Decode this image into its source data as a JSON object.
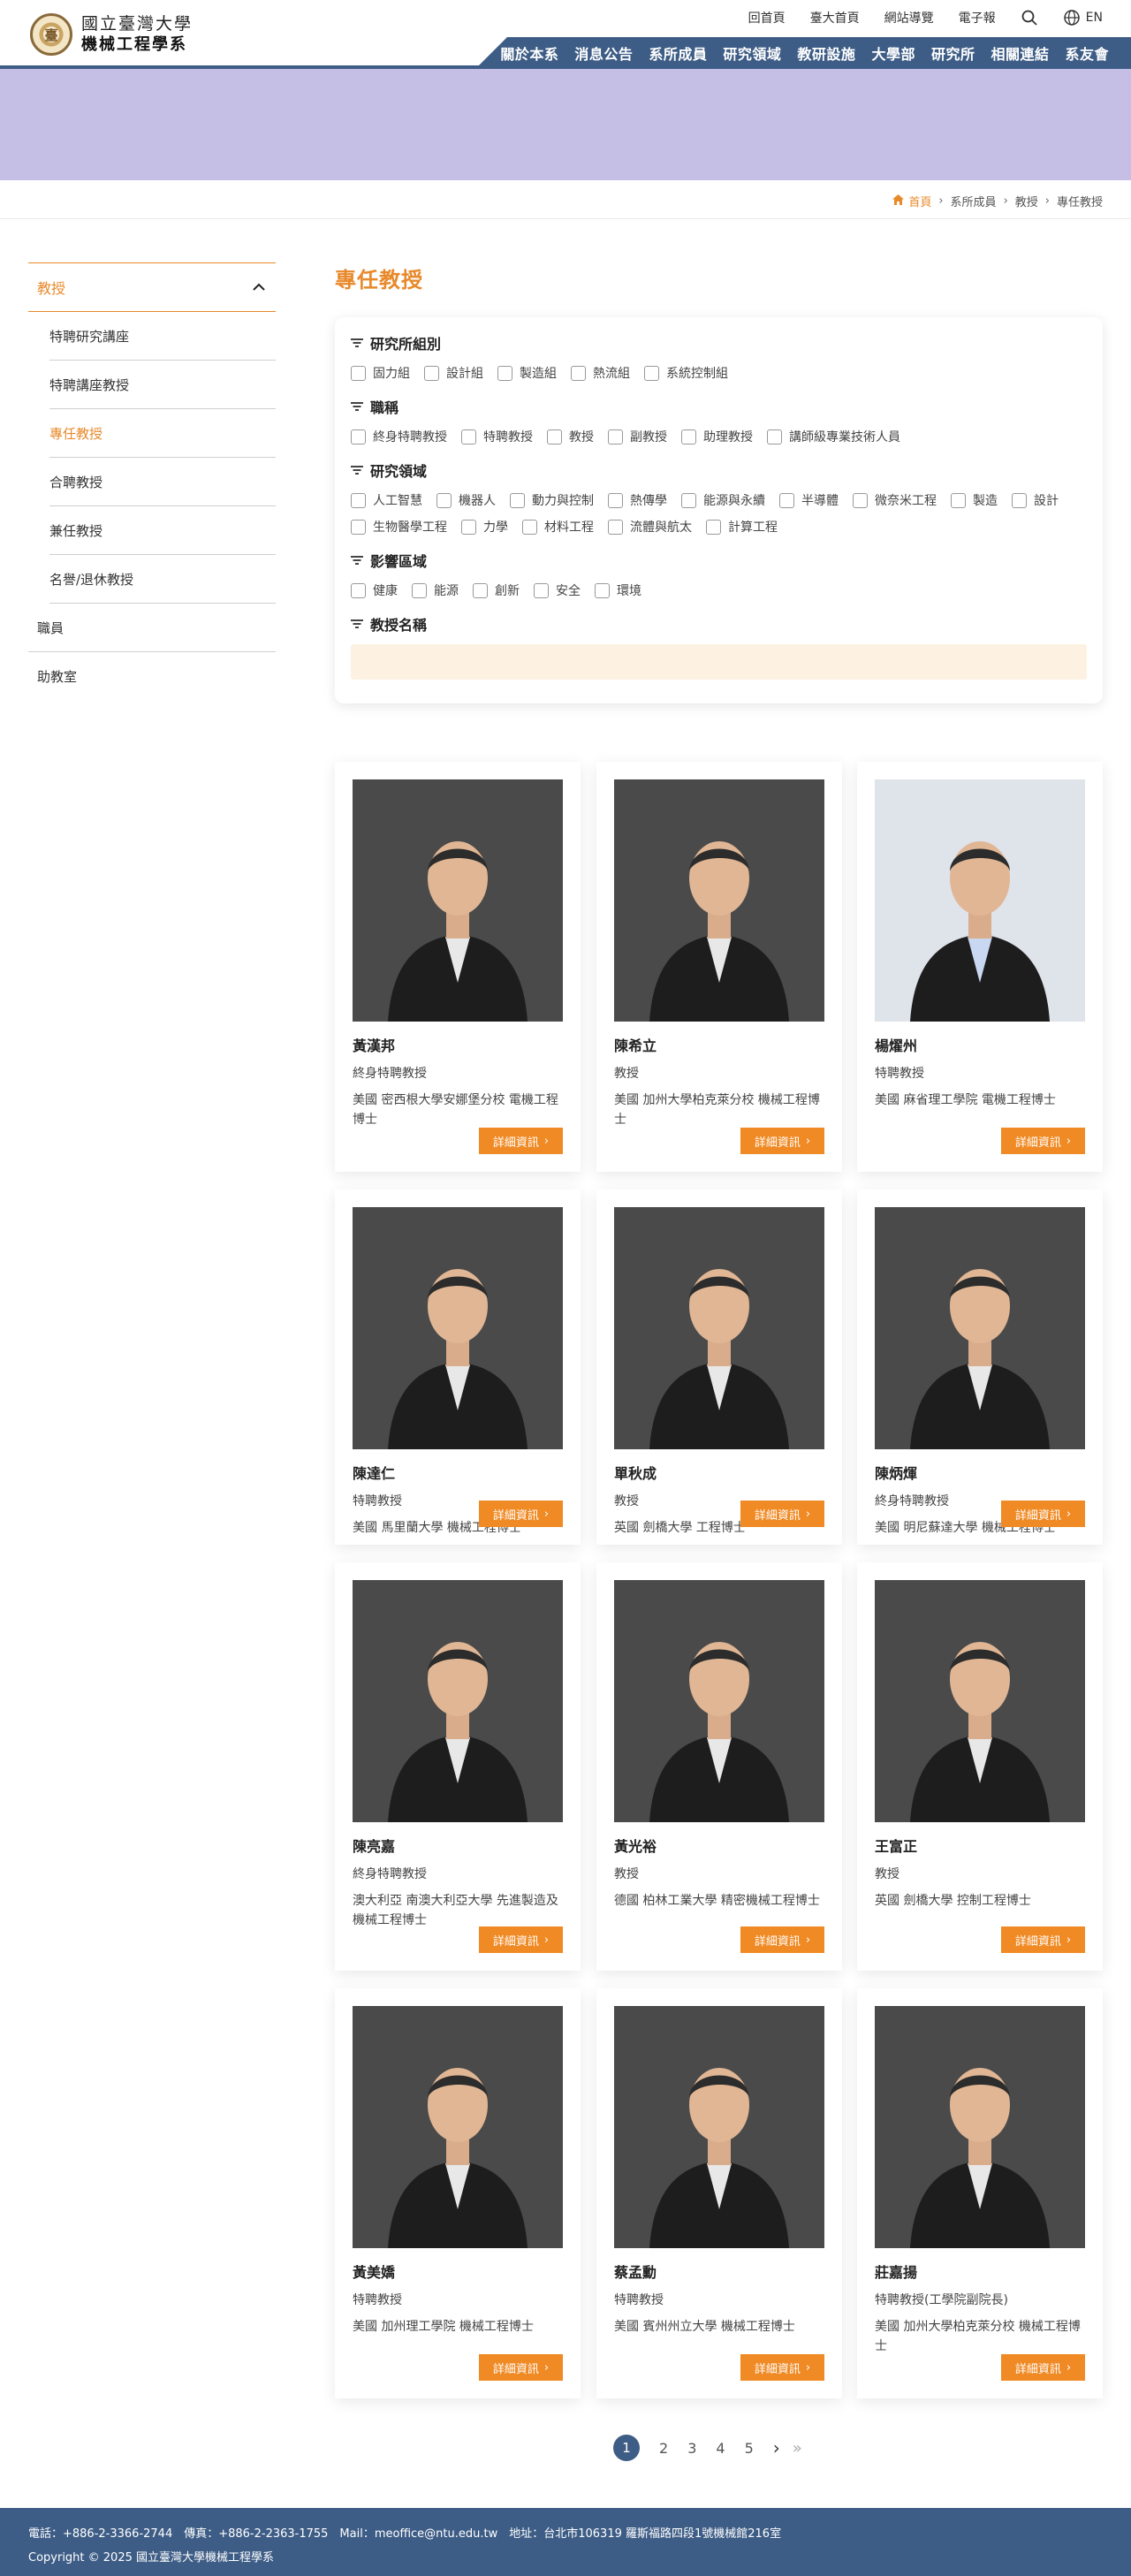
{
  "header": {
    "logo_line1": "國立臺灣大學",
    "logo_line2": "機械工程學系",
    "util_links": [
      "回首頁",
      "臺大首頁",
      "網站導覽",
      "電子報"
    ],
    "lang": "EN",
    "nav": [
      "關於本系",
      "消息公告",
      "系所成員",
      "研究領域",
      "教研設施",
      "大學部",
      "研究所",
      "相關連結",
      "系友會"
    ]
  },
  "breadcrumb": {
    "home": "首頁",
    "items": [
      "系所成員",
      "教授",
      "專任教授"
    ]
  },
  "sidebar": {
    "head": "教授",
    "sub": [
      "特聘研究講座",
      "特聘講座教授",
      "專任教授",
      "合聘教授",
      "兼任教授",
      "名譽/退休教授"
    ],
    "items": [
      "職員",
      "助教室"
    ]
  },
  "main": {
    "title": "專任教授",
    "filters": [
      {
        "title": "研究所組別",
        "options": [
          "固力組",
          "設計組",
          "製造組",
          "熱流組",
          "系統控制組"
        ]
      },
      {
        "title": "職稱",
        "options": [
          "終身特聘教授",
          "特聘教授",
          "教授",
          "副教授",
          "助理教授",
          "講師級專業技術人員"
        ]
      },
      {
        "title": "研究領域",
        "options": [
          "人工智慧",
          "機器人",
          "動力與控制",
          "熱傳學",
          "能源與永續",
          "半導體",
          "微奈米工程",
          "製造",
          "設計",
          "生物醫學工程",
          "力學",
          "材料工程",
          "流體與航太",
          "計算工程"
        ]
      },
      {
        "title": "影響區域",
        "options": [
          "健康",
          "能源",
          "創新",
          "安全",
          "環境"
        ]
      },
      {
        "title": "教授名稱",
        "options": []
      }
    ],
    "more_label": "詳細資訊",
    "profs": [
      {
        "name": "黃漢邦",
        "rank": "終身特聘教授",
        "degree": "美國 密西根大學安娜堡分校 電機工程博士"
      },
      {
        "name": "陳希立",
        "rank": "教授",
        "degree": "美國 加州大學柏克萊分校 機械工程博士"
      },
      {
        "name": "楊燿州",
        "rank": "特聘教授",
        "degree": "美國 麻省理工學院 電機工程博士"
      },
      {
        "name": "陳達仁",
        "rank": "特聘教授",
        "degree": "美國 馬里蘭大學 機械工程博士"
      },
      {
        "name": "單秋成",
        "rank": "教授",
        "degree": "英國 劍橋大學 工程博士"
      },
      {
        "name": "陳炳煇",
        "rank": "終身特聘教授",
        "degree": "美國 明尼蘇達大學 機械工程博士"
      },
      {
        "name": "陳亮嘉",
        "rank": "終身特聘教授",
        "degree": "澳大利亞 南澳大利亞大學 先進製造及機械工程博士"
      },
      {
        "name": "黃光裕",
        "rank": "教授",
        "degree": "德國 柏林工業大學 精密機械工程博士"
      },
      {
        "name": "王富正",
        "rank": "教授",
        "degree": "英國 劍橋大學 控制工程博士"
      },
      {
        "name": "黃美嬌",
        "rank": "特聘教授",
        "degree": "美國 加州理工學院 機械工程博士"
      },
      {
        "name": "蔡孟勳",
        "rank": "特聘教授",
        "degree": "美國 賓州州立大學 機械工程博士"
      },
      {
        "name": "莊嘉揚",
        "rank": "特聘教授(工學院副院長)",
        "degree": "美國 加州大學柏克萊分校 機械工程博士"
      }
    ]
  },
  "pager": {
    "pages": [
      "1",
      "2",
      "3",
      "4",
      "5"
    ],
    "current": "1"
  },
  "footer": {
    "line1": "電話：+886-2-3366-2744　傳真：+886-2-2363-1755　Mail：meoffice@ntu.edu.tw　地址：台北市106319 羅斯福路四段1號機械館216室",
    "line2": "Copyright © 2025 國立臺灣大學機械工程學系"
  },
  "colors": {
    "accent": "#e8892b",
    "navy": "#3e5d86",
    "banner": "#c5bfe6"
  }
}
